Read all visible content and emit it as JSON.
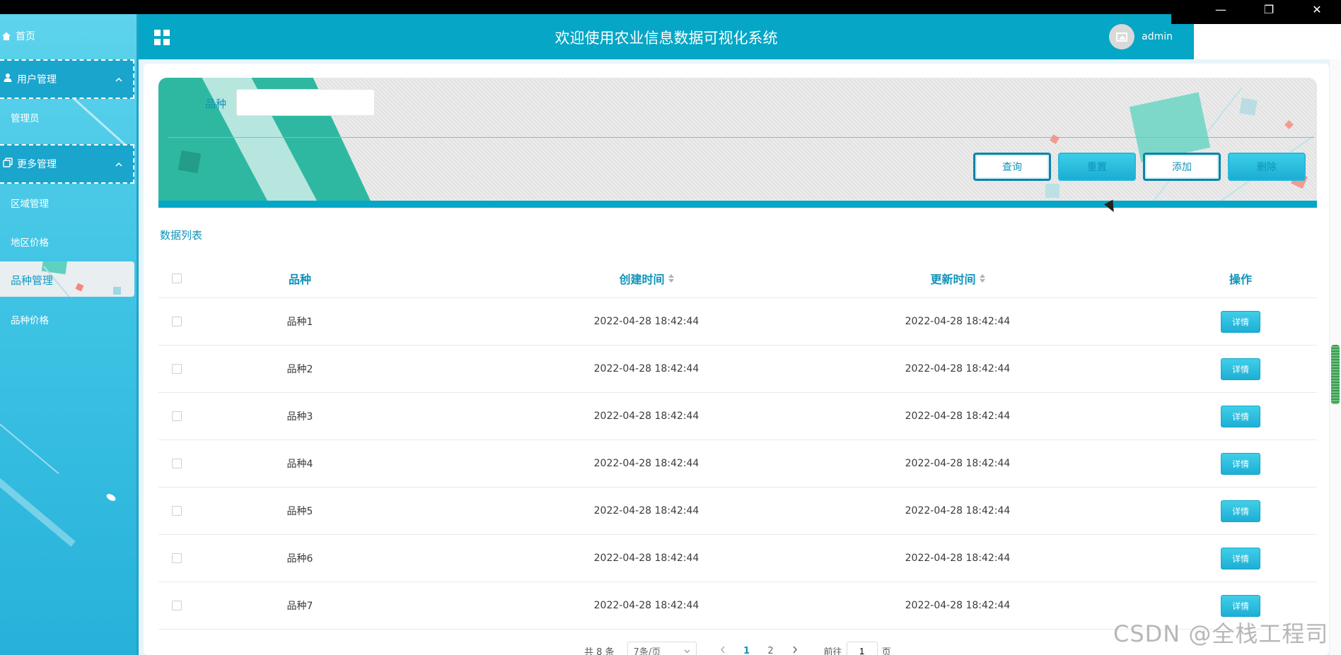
{
  "window": {
    "minimize_icon": "—",
    "restore_icon": "❐",
    "close_icon": "✕"
  },
  "sidebar": {
    "home": "首页",
    "groups": [
      {
        "label": "用户管理",
        "icon": "user-icon",
        "items": [
          "管理员"
        ]
      },
      {
        "label": "更多管理",
        "icon": "copy-icon",
        "items": [
          "区域管理",
          "地区价格",
          "品种管理",
          "品种价格"
        ]
      }
    ],
    "active_item": "品种管理"
  },
  "header": {
    "title": "欢迎使用农业信息数据可视化系统",
    "username": "admin"
  },
  "search": {
    "label": "品种",
    "value": "",
    "placeholder": "",
    "buttons": {
      "query": "查询",
      "reset": "重置",
      "add": "添加",
      "delete": "删除"
    }
  },
  "list": {
    "title": "数据列表",
    "columns": {
      "name": "品种",
      "created": "创建时间",
      "updated": "更新时间",
      "action": "操作"
    },
    "rows": [
      {
        "name": "品种1",
        "created": "2022-04-28 18:42:44",
        "updated": "2022-04-28 18:42:44",
        "action": "详情"
      },
      {
        "name": "品种2",
        "created": "2022-04-28 18:42:44",
        "updated": "2022-04-28 18:42:44",
        "action": "详情"
      },
      {
        "name": "品种3",
        "created": "2022-04-28 18:42:44",
        "updated": "2022-04-28 18:42:44",
        "action": "详情"
      },
      {
        "name": "品种4",
        "created": "2022-04-28 18:42:44",
        "updated": "2022-04-28 18:42:44",
        "action": "详情"
      },
      {
        "name": "品种5",
        "created": "2022-04-28 18:42:44",
        "updated": "2022-04-28 18:42:44",
        "action": "详情"
      },
      {
        "name": "品种6",
        "created": "2022-04-28 18:42:44",
        "updated": "2022-04-28 18:42:44",
        "action": "详情"
      },
      {
        "name": "品种7",
        "created": "2022-04-28 18:42:44",
        "updated": "2022-04-28 18:42:44",
        "action": "详情"
      }
    ]
  },
  "pagination": {
    "total": "共 8 条",
    "page_size": "7条/页",
    "pages": [
      "1",
      "2"
    ],
    "current": "1",
    "goto_prefix": "前往",
    "goto_value": "1",
    "goto_suffix": "页"
  },
  "watermark": "CSDN @全栈工程司",
  "colors": {
    "primary": "#05a6c6",
    "accent_text": "#0f93b9",
    "sidebar_top": "#5ed3ec",
    "sidebar_bottom": "#27b1da"
  }
}
